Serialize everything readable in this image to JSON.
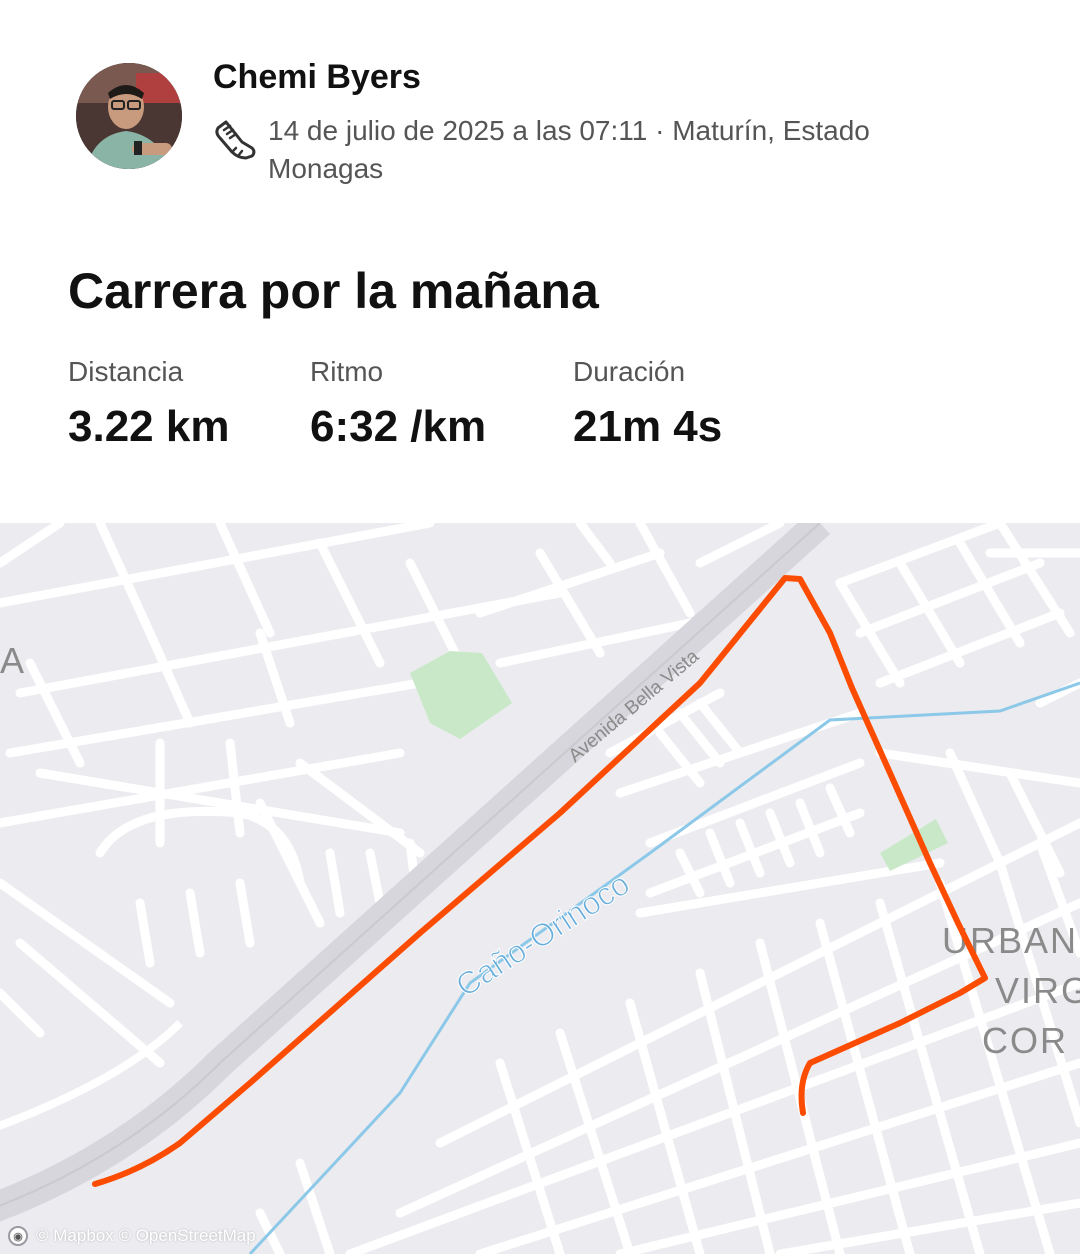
{
  "activity": {
    "athlete_name": "Chemi Byers",
    "sport_icon": "running-shoe-icon",
    "datetime_location": "14 de julio de 2025 a las 07:11 · Maturín, Estado Monagas",
    "title": "Carrera por la mañana"
  },
  "stats": [
    {
      "label": "Distancia",
      "value": "3.22 km"
    },
    {
      "label": "Ritmo",
      "value": "6:32 /km"
    },
    {
      "label": "Duración",
      "value": "21m 4s"
    }
  ],
  "map": {
    "street_label": "Avenida Bella Vista",
    "river_label": "Caño-Orinoco",
    "area_label_left": "A",
    "area_label_right": [
      "URBAN",
      "VIRG",
      "COR"
    ],
    "attribution": "© Mapbox © OpenStreetMap",
    "route_color": "#fc4c02",
    "water_color": "#8cc8e8",
    "park_color": "#c8e8c8"
  }
}
